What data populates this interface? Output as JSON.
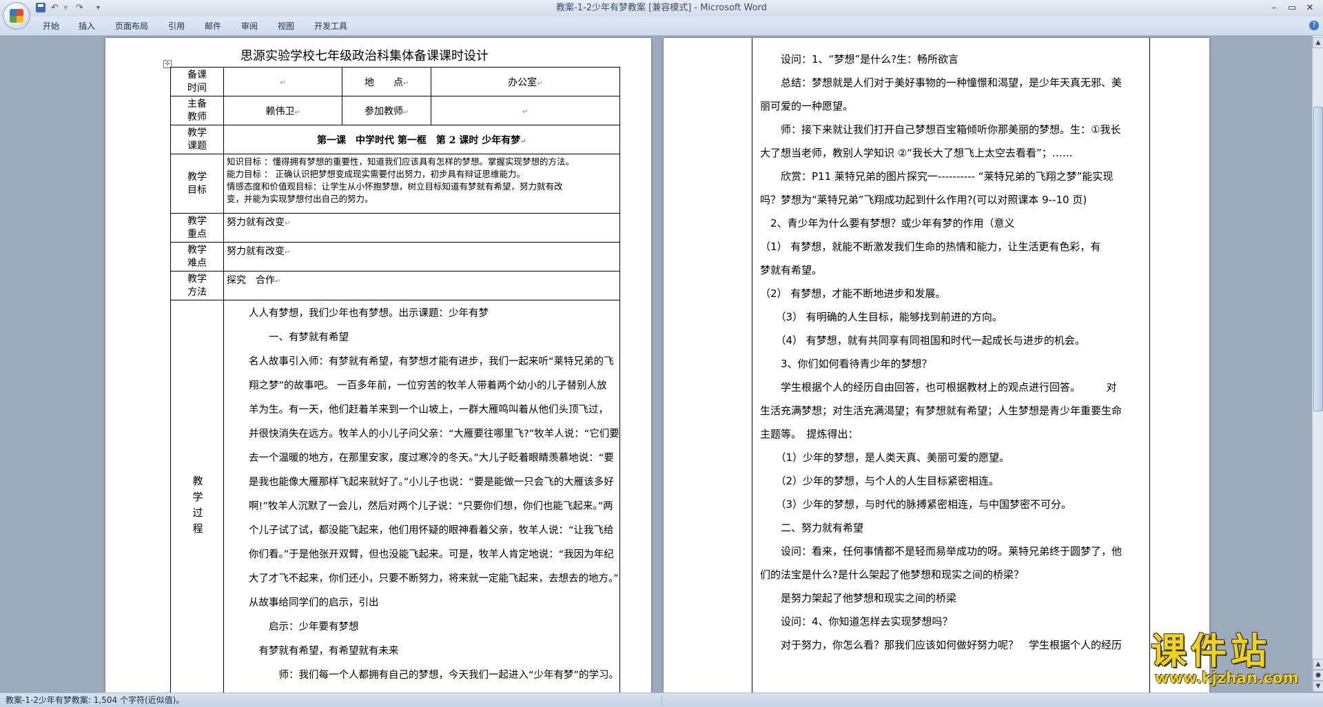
{
  "window": {
    "title": "教案-1-2少年有梦教案 [兼容模式] - Microsoft Word",
    "controls": [
      "–",
      "▭",
      "✕"
    ]
  },
  "ribbon": {
    "tabs": [
      "开始",
      "插入",
      "页面布局",
      "引用",
      "邮件",
      "审阅",
      "视图",
      "开发工具"
    ]
  },
  "page1": {
    "title": "思源实验学校七年级政治科集体备课课时设计",
    "table": {
      "row1": {
        "label": "备课\n时间",
        "time_value": "",
        "location_label": "地　　点",
        "location_value": "办公室"
      },
      "row2": {
        "label": "主备\n教师",
        "teacher_value": "赖伟卫",
        "participants_label": "参加教师",
        "participants_value": ""
      },
      "row3": {
        "label": "教学\n课题",
        "topic": "第一课　中学时代  第一框　第 2 课时  少年有梦"
      },
      "row4": {
        "label": "教学\n目标",
        "goals": [
          "知识目标 ：懂得拥有梦想的重要性，知道我们应该具有怎样的梦想。掌握实现梦想的方法。",
          "能力目标 ：  正确认识把梦想变成现实需要付出努力，初步具有辩证思维能力。",
          "情感态度和价值观目标：让学生从小怀抱梦想，树立目标知道有梦就有希望，努力就有改",
          "变，并能为实现梦想付出自己的努力。"
        ]
      },
      "row5": {
        "label": "教学\n重点",
        "value": "努力就有改变"
      },
      "row6": {
        "label": "教学\n难点",
        "value": "努力就有改变"
      },
      "row7": {
        "label": "教学\n方法",
        "value": "探究　合作"
      },
      "row8": {
        "label": "教学过程",
        "lines": [
          "人人有梦想，我们少年也有梦想。出示课题：少年有梦",
          "　　一、有梦就有希望",
          "名人故事引入师：有梦就有希望，有梦想才能有进步，我们一起来听“莱特兄弟的飞",
          "翔之梦”的故事吧。 一百多年前，一位穷苦的牧羊人带着两个幼小的儿子替别人放",
          "羊为生。有一天，他们赶着羊来到一个山坡上，一群大雁鸣叫着从他们头顶飞过，",
          "并很快消失在远方。牧羊人的小儿子问父亲：“大雁要往哪里飞?”牧羊人说：“它们要",
          "去一个温暖的地方，在那里安家，度过寒冷的冬天。”大儿子眨着眼睛羡慕地说：“要",
          "是我也能像大雁那样飞起来就好了。”小儿子也说：“要是能做一只会飞的大雁该多好",
          "啊!”牧羊人沉默了一会儿，然后对两个儿子说：“只要你们想，你们也能飞起来。”两",
          "个儿子试了试，都没能飞起来，他们用怀疑的眼神看着父亲，牧羊人说：“让我飞给",
          "你们看。”于是他张开双臂，但也没能飞起来。可是，牧羊人肯定地说：“我因为年纪",
          "大了才飞不起来，你们还小，只要不断努力，将来就一定能飞起来，去想去的地方。”",
          "从故事给同学们的启示，引出",
          "　　启示：少年要有梦想",
          "　有梦就有希望，有希望就有未来",
          "　　　师：我们每一个人都拥有自己的梦想，今天我们一起进入“少年有梦”的学习。"
        ]
      }
    }
  },
  "page2": {
    "lines": [
      "　　设问：1、“梦想”是什么?生：畅所欲言",
      "　　总结：梦想就是人们对于美好事物的一种憧憬和渴望，是少年天真无邪、美",
      "丽可爱的一种愿望。",
      "　　师：接下来就让我们打开自己梦想百宝箱倾听你那美丽的梦想。生：①我长",
      "大了想当老师，教别人学知识  ②“我长大了想飞上太空去看看”；……",
      "　　欣赏：P11 莱特兄弟的图片探究一----------  “莱特兄弟的飞翔之梦”能实现",
      "吗？梦想为“莱特兄弟”飞翔成功起到什么作用?(可以对照课本 9--10 页)",
      "　2、青少年为什么要有梦想？或少年有梦的作用（意义",
      "（1） 有梦想，就能不断激发我们生命的热情和能力，让生活更有色彩，有",
      "梦就有希望。",
      "（2） 有梦想，才能不断地进步和发展。",
      "　　（3） 有明确的人生目标，能够找到前进的方向。",
      "　　（4） 有梦想，就有共同享有同祖国和时代一起成长与进步的机会。",
      "　　3、你们如何看待青少年的梦想？",
      "　　学生根据个人的经历自由回答，也可根据教材上的观点进行回答。　　　对",
      "生活充满梦想；对生活充满渴望；有梦想就有希望；人生梦想是青少年重要生命",
      "主题等。　提炼得出：",
      "　　（1）少年的梦想，是人类天真、美丽可爱的愿望。",
      "　　（2）少年的梦想，与个人的人生目标紧密相连。",
      "　　（3）少年的梦想，与时代的脉搏紧密相连，与中国梦密不可分。",
      "　　二、努力就有希望",
      "　　设问：看来，任何事情都不是轻而易举成功的呀。莱特兄弟终于圆梦了，他",
      "们的法宝是什么?是什么架起了他梦想和现实之间的桥梁？",
      "　　是努力架起了他梦想和现实之间的桥梁",
      "　　设问：4、你知道怎样去实现梦想吗？",
      "　　对于努力，你怎么看？那我们应该如何做好努力呢？　学生根据个人的经历"
    ]
  },
  "watermark": {
    "main": "课件站",
    "url": "www.kjzhan.com"
  },
  "statusbar": {
    "text": "教案-1-2少年有梦教案: 1,504 个字符(近似值)。"
  }
}
